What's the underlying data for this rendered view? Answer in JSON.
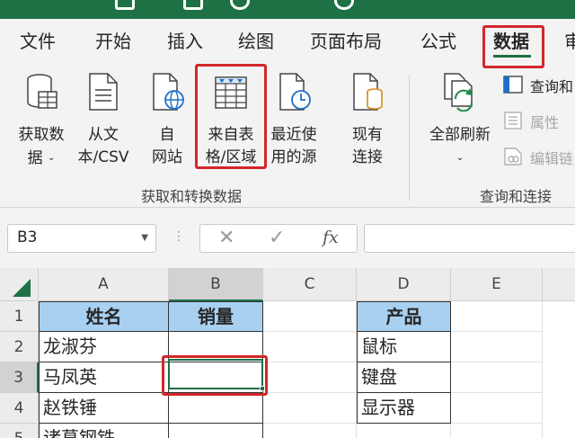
{
  "ribbon_tabs": [
    "文件",
    "开始",
    "插入",
    "绘图",
    "页面布局",
    "公式",
    "数据",
    "审"
  ],
  "active_tab": "数据",
  "ribbon": {
    "get_transform": {
      "buttons": [
        {
          "line1": "获取数",
          "line2": "据",
          "caret": "⌄",
          "icon": "database-table-icon"
        },
        {
          "line1": "从文",
          "line2": "本/CSV",
          "icon": "text-file-icon"
        },
        {
          "line1": "自",
          "line2": "网站",
          "icon": "web-globe-icon"
        },
        {
          "line1": "来自表",
          "line2": "格/区域",
          "icon": "table-range-icon"
        },
        {
          "line1": "最近使",
          "line2": "用的源",
          "icon": "recent-sources-icon"
        },
        {
          "line1": "现有",
          "line2": "连接",
          "icon": "existing-connections-icon"
        }
      ],
      "label": "获取和转换数据"
    },
    "queries": {
      "refresh_all": {
        "line1": "全部刷新",
        "caret": "⌄",
        "icon": "refresh-all-icon"
      },
      "small_buttons": [
        {
          "label": "查询和",
          "icon": "queries-connections-icon",
          "enabled": true
        },
        {
          "label": "属性",
          "icon": "properties-icon",
          "enabled": false
        },
        {
          "label": "编辑链",
          "icon": "edit-links-icon",
          "enabled": false
        }
      ],
      "label": "查询和连接"
    }
  },
  "formula_bar": {
    "name_box": "B3",
    "cancel_symbol": "✕",
    "enter_symbol": "✓",
    "fx_label": "fx",
    "formula": ""
  },
  "sheet": {
    "columns": [
      "A",
      "B",
      "C",
      "D",
      "E"
    ],
    "rows": [
      "1",
      "2",
      "3",
      "4",
      "5"
    ],
    "selected_cell": "B3",
    "cells": {
      "A1": "姓名",
      "B1": "销量",
      "D1": "产品",
      "A2": "龙淑芬",
      "D2": "鼠标",
      "A3": "马凤英",
      "D3": "键盘",
      "A4": "赵铁锤",
      "D4": "显示器",
      "A5": "诸葛钢铁"
    }
  },
  "colors": {
    "excel_green": "#1e7145",
    "highlight_red": "#d2272b",
    "header_fill": "#a8d0f0"
  }
}
